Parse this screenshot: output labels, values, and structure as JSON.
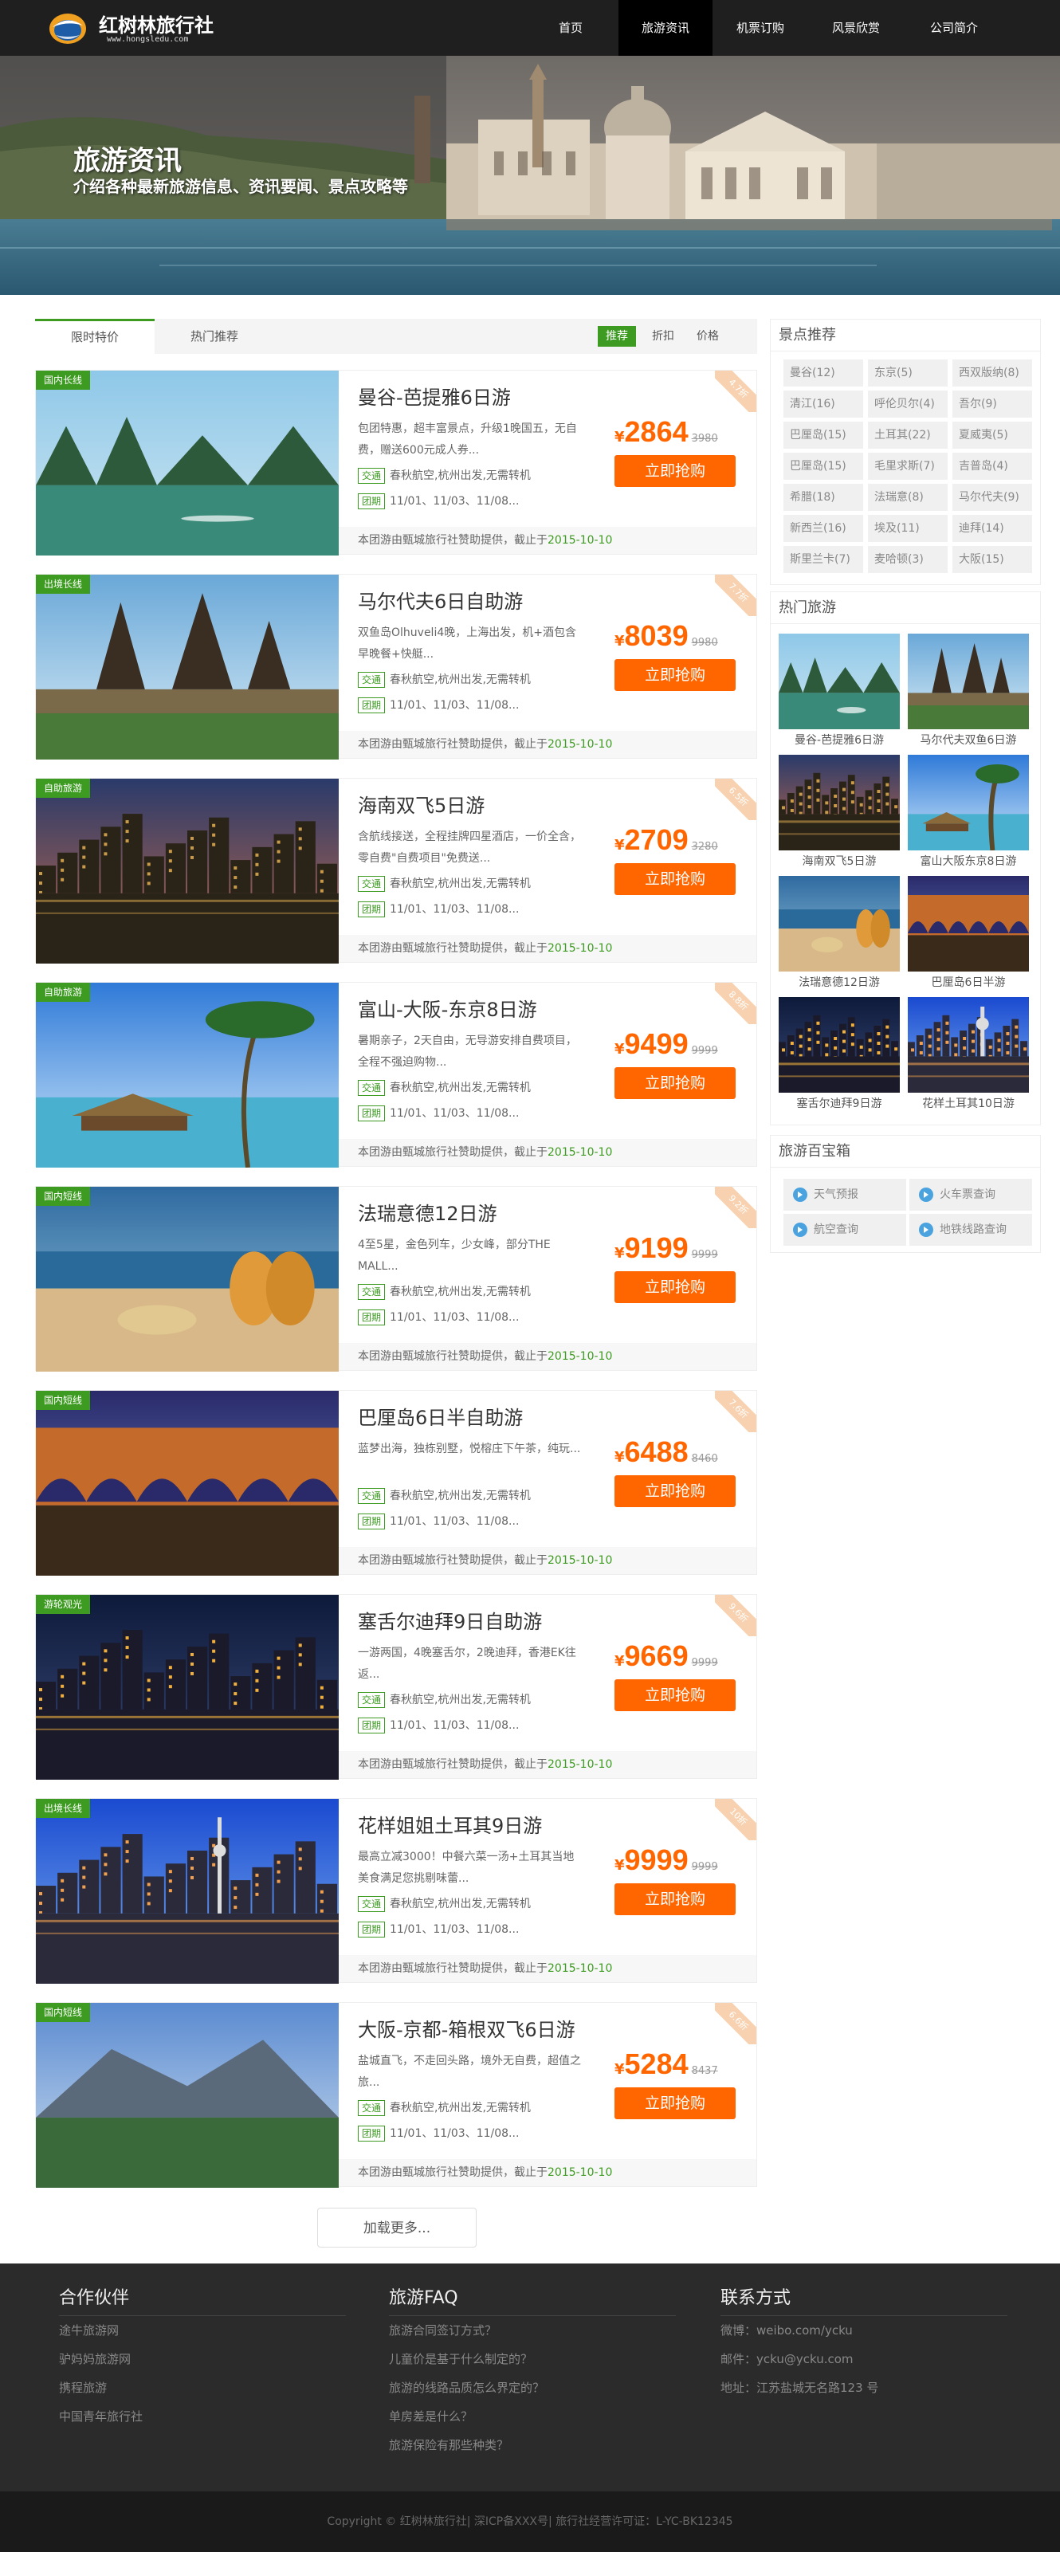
{
  "site": {
    "name": "红树林旅行社",
    "url": "www.hongsledu.com"
  },
  "nav": [
    "首页",
    "旅游资讯",
    "机票订购",
    "风景欣赏",
    "公司简介"
  ],
  "banner": {
    "title": "旅游资讯",
    "subtitle": "介绍各种最新旅游信息、资讯要闻、景点攻略等"
  },
  "tabs": [
    "限时特价",
    "热门推荐"
  ],
  "sort": [
    "推荐",
    "折扣",
    "价格"
  ],
  "tag_labels": {
    "traffic": "交通",
    "tour": "团期"
  },
  "sponsor": {
    "text": "本团游由甄城旅行社赞助提供，截止于",
    "date": "2015-10-10"
  },
  "currency": "¥",
  "buy_label": "立即抢购",
  "products": [
    {
      "label": "国内长线",
      "title": "曼谷-芭提雅6日游",
      "desc": "包团特惠，超丰富景点，升级1晚国五，无自费，赠送600元成人券...",
      "traffic": "春秋航空,杭州出发,无需转机",
      "dates": "11/01、11/03、11/08...",
      "price": "2864",
      "old": "3980",
      "discount": "4.7折"
    },
    {
      "label": "出境长线",
      "title": "马尔代夫6日自助游",
      "desc": "双鱼岛Olhuveli4晚，上海出发，机+酒包含 早晚餐+快艇...",
      "traffic": "春秋航空,杭州出发,无需转机",
      "dates": "11/01、11/03、11/08...",
      "price": "8039",
      "old": "9980",
      "discount": "7.7折"
    },
    {
      "label": "自助旅游",
      "title": "海南双飞5日游",
      "desc": "含航线接送，全程挂牌四星酒店，一价全含，零自费\"自费项目\"免费送...",
      "traffic": "春秋航空,杭州出发,无需转机",
      "dates": "11/01、11/03、11/08...",
      "price": "2709",
      "old": "3280",
      "discount": "6.5折"
    },
    {
      "label": "自助旅游",
      "title": "富山-大阪-东京8日游",
      "desc": "暑期亲子，2天自由，无导游安排自费项目，全程不强迫购物...",
      "traffic": "春秋航空,杭州出发,无需转机",
      "dates": "11/01、11/03、11/08...",
      "price": "9499",
      "old": "9999",
      "discount": "8.8折"
    },
    {
      "label": "国内短线",
      "title": "法瑞意德12日游",
      "desc": "4至5星，金色列车，少女峰，部分THE MALL...",
      "traffic": "春秋航空,杭州出发,无需转机",
      "dates": "11/01、11/03、11/08...",
      "price": "9199",
      "old": "9999",
      "discount": "9.2折"
    },
    {
      "label": "国内短线",
      "title": "巴厘岛6日半自助游",
      "desc": "蓝梦出海，独栋别墅，悦榕庄下午茶，纯玩...",
      "traffic": "春秋航空,杭州出发,无需转机",
      "dates": "11/01、11/03、11/08...",
      "price": "6488",
      "old": "8460",
      "discount": "7.6折"
    },
    {
      "label": "游轮观光",
      "title": "塞舌尔迪拜9日自助游",
      "desc": "一游两国，4晚塞舌尔，2晚迪拜，香港EK往返...",
      "traffic": "春秋航空,杭州出发,无需转机",
      "dates": "11/01、11/03、11/08...",
      "price": "9669",
      "old": "9999",
      "discount": "9.6折"
    },
    {
      "label": "出境长线",
      "title": "花样姐姐土耳其9日游",
      "desc": "最高立减3000！中餐六菜一汤+土耳其当地美食满足您挑剔味蕾...",
      "traffic": "春秋航空,杭州出发,无需转机",
      "dates": "11/01、11/03、11/08...",
      "price": "9999",
      "old": "9999",
      "discount": "10折"
    },
    {
      "label": "国内短线",
      "title": "大阪-京都-箱根双飞6日游",
      "desc": "盐城直飞，不走回头路，境外无自费，超值之旅...",
      "traffic": "春秋航空,杭州出发,无需转机",
      "dates": "11/01、11/03、11/08...",
      "price": "5284",
      "old": "8437",
      "discount": "6.6折"
    }
  ],
  "load_more": "加载更多...",
  "sidebar": {
    "spots_title": "景点推荐",
    "spots": [
      "曼谷(12)",
      "东京(5)",
      "西双版纳(8)",
      "清江(16)",
      "呼伦贝尔(4)",
      "吾尔(9)",
      "巴厘岛(15)",
      "土耳其(22)",
      "夏威夷(5)",
      "巴厘岛(15)",
      "毛里求斯(7)",
      "吉普岛(4)",
      "希腊(18)",
      "法瑞意(8)",
      "马尔代夫(9)",
      "新西兰(16)",
      "埃及(11)",
      "迪拜(14)",
      "斯里兰卡(7)",
      "麦哈顿(3)",
      "大阪(15)"
    ],
    "hot_title": "热门旅游",
    "hot": [
      "曼谷-芭提雅6日游",
      "马尔代夫双鱼6日游",
      "海南双飞5日游",
      "富山大阪东京8日游",
      "法瑞意德12日游",
      "巴厘岛6日半游",
      "塞舌尔迪拜9日游",
      "花样土耳其10日游"
    ],
    "tools_title": "旅游百宝箱",
    "tools": [
      "天气预报",
      "火车票查询",
      "航空查询",
      "地铁线路查询"
    ]
  },
  "footer": {
    "partners_title": "合作伙伴",
    "partners": [
      "途牛旅游网",
      "驴妈妈旅游网",
      "携程旅游",
      "中国青年旅行社"
    ],
    "faq_title": "旅游FAQ",
    "faq": [
      "旅游合同签订方式？",
      "儿童价是基于什么制定的？",
      "旅游的线路品质怎么界定的？",
      "单房差是什么？",
      "旅游保险有那些种类？"
    ],
    "contact_title": "联系方式",
    "contact": [
      "微博：weibo.com/ycku",
      "邮件：ycku@ycku.com",
      "地址：江苏盐城无名路123 号"
    ],
    "copyright": "Copyright © 红树林旅行社| 深ICP备XXX号| 旅行社经营许可证：L-YC-BK12345"
  }
}
